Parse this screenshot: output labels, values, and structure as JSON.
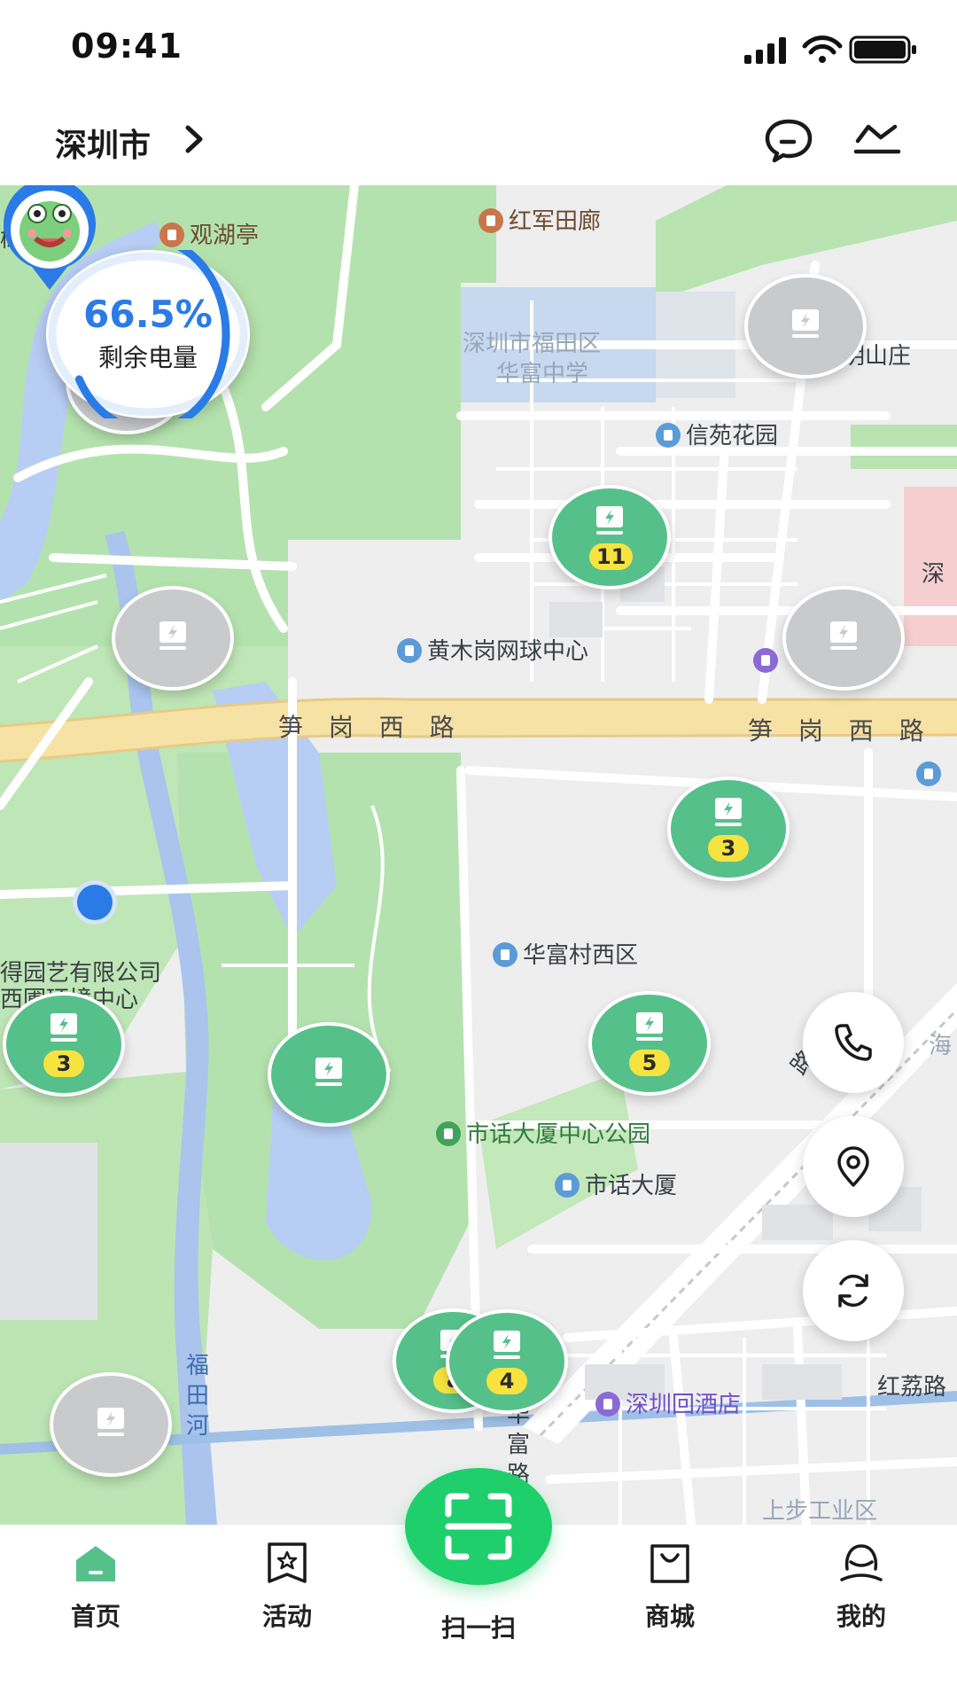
{
  "status_bar": {
    "time": "09:41"
  },
  "header": {
    "city": "深圳市"
  },
  "battery": {
    "percent_text": "66.5%",
    "label": "剩余电量",
    "level": 0.665
  },
  "map": {
    "roads": {
      "west_label": "笋 岗 西 路",
      "east_label": "笋 岗 西 路"
    },
    "labels": {
      "shulin": "树林",
      "guanhuting": "观湖亭",
      "hongjuntianlang": "红军田廊",
      "school": "深圳市福田区",
      "school2": "华富中学",
      "mingshanzhuang": "明山庄",
      "xinyuan": "信苑花园",
      "tennis": "黄木岗网球中心",
      "market": "市",
      "huafu_west": "华富村西区",
      "garden_company": "得园艺有限公司",
      "garden_center": "西圃环境中心",
      "park": "市话大厦中心公园",
      "building": "市话大厦",
      "hotel": "深圳回酒店",
      "futian_river": "福\n田\n河",
      "huafu_road": "华\n富\n路",
      "hongli": "红荔路",
      "shangbu": "上步工业区",
      "hai": "海",
      "shen": "深",
      "xieroad": "路"
    },
    "stations": [
      {
        "count": "",
        "status": "inactive"
      },
      {
        "count": "",
        "status": "inactive"
      },
      {
        "count": "11",
        "status": "active"
      },
      {
        "count": "",
        "status": "inactive"
      },
      {
        "count": "3",
        "status": "active"
      },
      {
        "count": "3",
        "status": "active"
      },
      {
        "count": "",
        "status": "active"
      },
      {
        "count": "5",
        "status": "active"
      },
      {
        "count": "8",
        "status": "active"
      },
      {
        "count": "4",
        "status": "active"
      },
      {
        "count": "",
        "status": "inactive"
      },
      {
        "count": "",
        "status": "inactive"
      }
    ]
  },
  "floating_buttons": {
    "call": "phone-icon",
    "locate": "location-icon",
    "refresh": "refresh-icon"
  },
  "tabbar": {
    "home": "首页",
    "activity": "活动",
    "scan": "扫一扫",
    "mall": "商城",
    "mine": "我的"
  },
  "colors": {
    "accent_green": "#56c08a",
    "scan_green": "#1fcf6c",
    "battery_blue": "#2a7be6",
    "count_yellow": "#f7e340"
  }
}
